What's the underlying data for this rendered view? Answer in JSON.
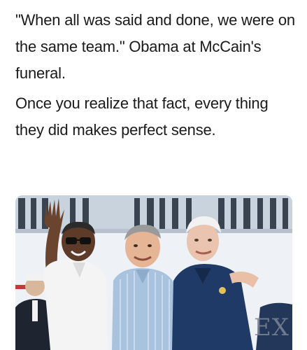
{
  "post": {
    "paragraph_1": "\"When all was said and done, we were on the same team.\" Obama at McCain's funeral.",
    "paragraph_2": "Once you realize that fact, every thing they did makes perfect sense."
  },
  "photo": {
    "background_text": "EX",
    "subjects": [
      "man-waving-white-polo",
      "man-light-blue-striped-shirt",
      "man-navy-polo"
    ]
  },
  "colors": {
    "text": "#1a1a1a",
    "sky": "#dfe6ee",
    "navy_polo": "#1f3a66",
    "white_polo": "#f4f4f4",
    "striped_shirt": "#a9c3de"
  }
}
